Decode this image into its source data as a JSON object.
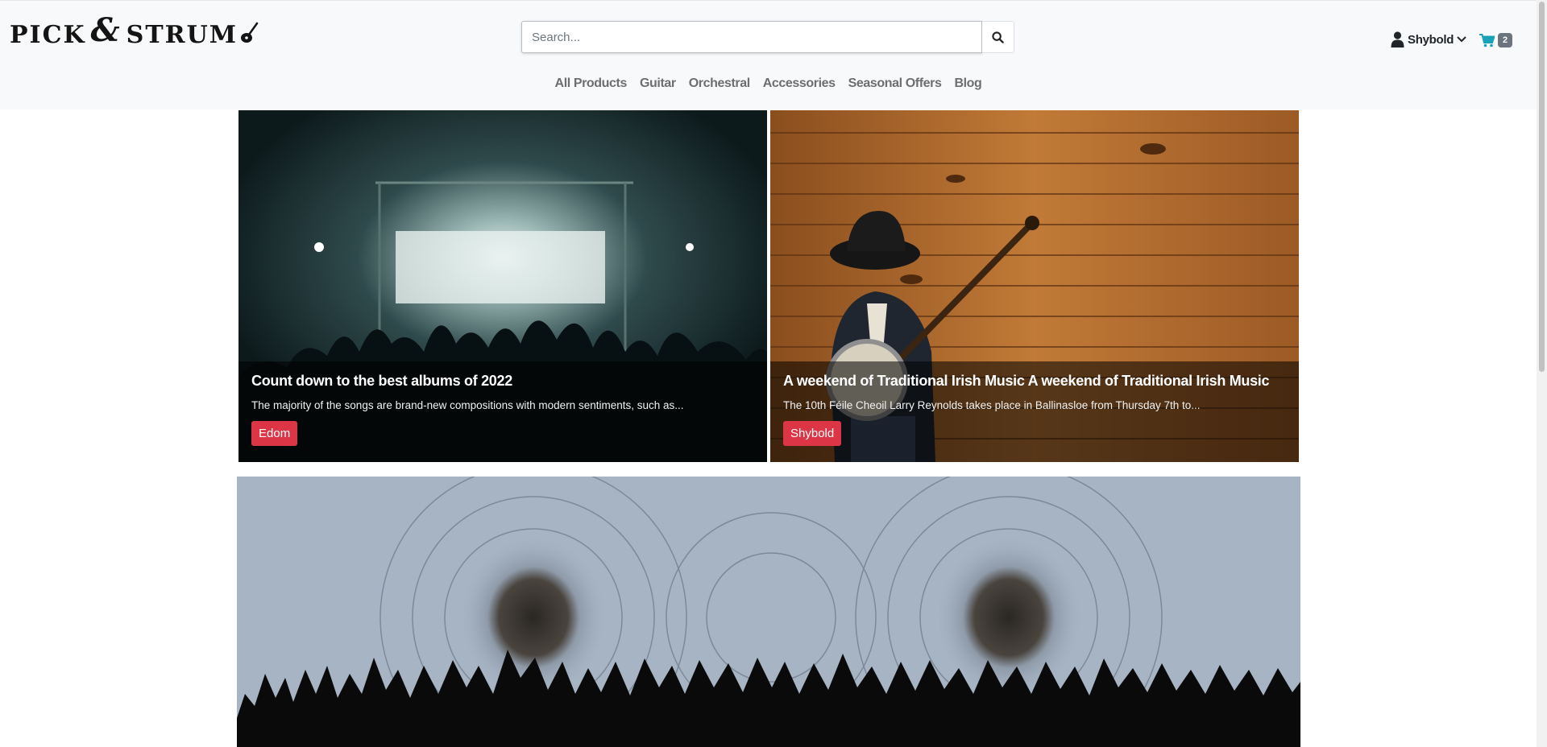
{
  "brand": {
    "name_part1": "PICK",
    "amp": "&",
    "name_part2": "STRUM"
  },
  "search": {
    "placeholder": "Search...",
    "value": ""
  },
  "user": {
    "name": "Shybold"
  },
  "cart": {
    "count": "2"
  },
  "nav": {
    "items": [
      {
        "label": "All Products"
      },
      {
        "label": "Guitar"
      },
      {
        "label": "Orchestral"
      },
      {
        "label": "Accessories"
      },
      {
        "label": "Seasonal Offers"
      },
      {
        "label": "Blog"
      }
    ]
  },
  "posts": [
    {
      "title": "Count down to the best albums of 2022",
      "excerpt": "The majority of the songs are brand-new compositions with modern sentiments, such as...",
      "author": "Edom"
    },
    {
      "title": "A weekend of Traditional Irish Music A weekend of Traditional Irish Music",
      "excerpt": "The 10th Féile Cheoil Larry Reynolds takes place in Ballinasloe from Thursday 7th to...",
      "author": "Shybold"
    }
  ],
  "colors": {
    "accent_red": "#dc3545",
    "cart_blue": "#17a2b8",
    "navbar_bg": "#f8f9fa"
  },
  "icons": {
    "search": "search-icon",
    "user": "user-icon",
    "chevron": "chevron-down-icon",
    "cart": "cart-icon"
  }
}
